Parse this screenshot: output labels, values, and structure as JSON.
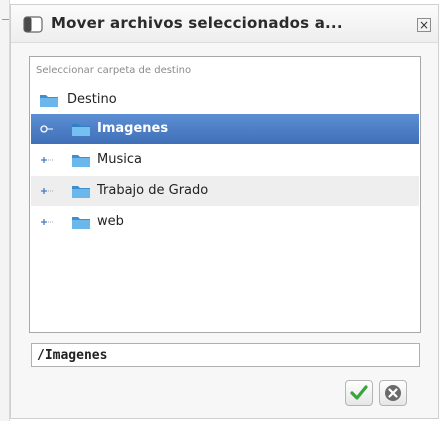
{
  "dialog": {
    "title": "Mover archivos seleccionados a...",
    "close_glyph": "×"
  },
  "panel": {
    "label": "Seleccionar carpeta de destino"
  },
  "tree": {
    "root": {
      "label": "Destino",
      "icon": "folder-icon"
    },
    "children": [
      {
        "label": "Imagenes",
        "selected": true,
        "icon": "folder-icon"
      },
      {
        "label": "Musica",
        "selected": false,
        "icon": "folder-icon"
      },
      {
        "label": "Trabajo de Grado",
        "selected": false,
        "hover": true,
        "icon": "folder-icon"
      },
      {
        "label": "web",
        "selected": false,
        "icon": "folder-icon"
      }
    ]
  },
  "path_field": {
    "value": "/Imagenes"
  },
  "buttons": {
    "ok_icon": "checkmark-icon",
    "cancel_icon": "cancel-icon"
  },
  "colors": {
    "selection": "#4a7cc4",
    "folder": "#5aa8e0",
    "ok_green": "#3aa53a",
    "cancel_gray": "#6a6a6a"
  }
}
